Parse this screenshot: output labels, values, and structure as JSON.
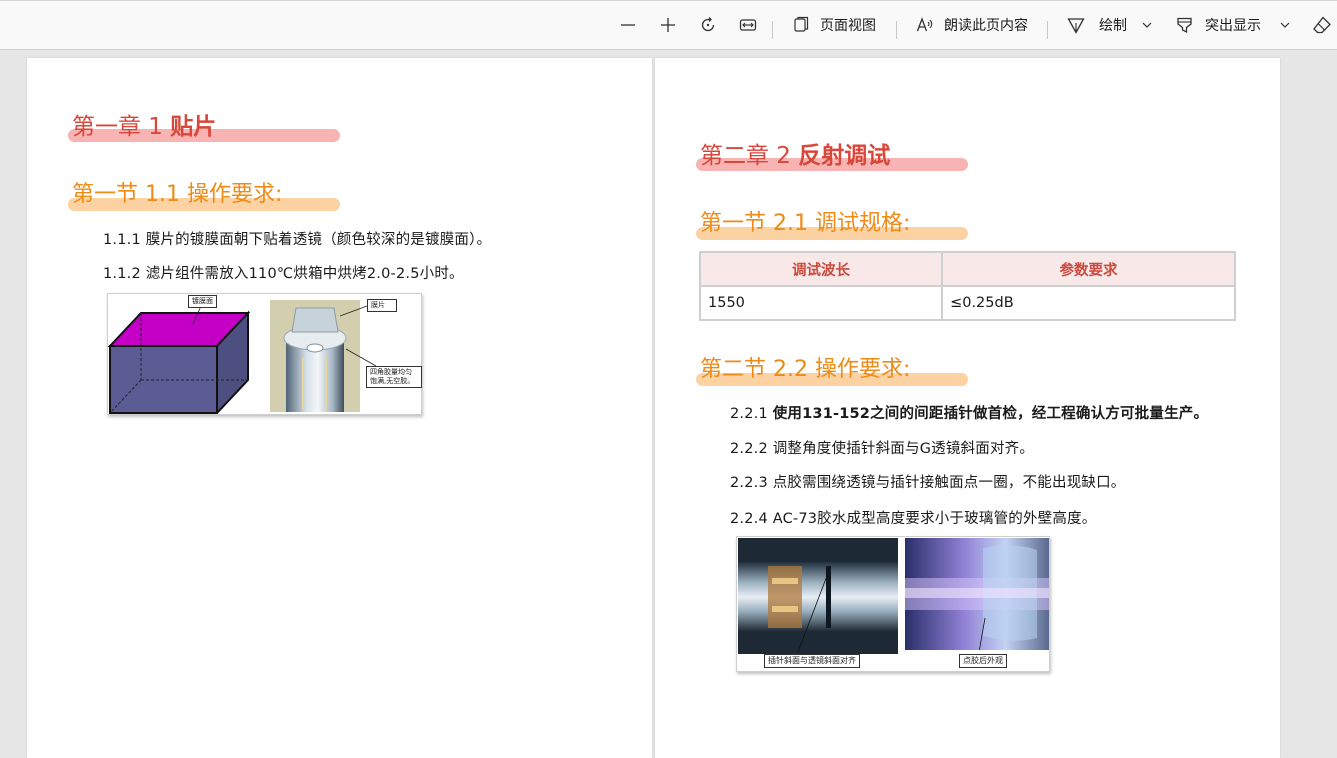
{
  "toolbar": {
    "zoom_out": "zoom-out",
    "zoom_in": "zoom-in",
    "rotate": "rotate",
    "fit_width": "fit-width",
    "page_view_label": "页面视图",
    "read_aloud_label": "朗读此页内容",
    "draw_label": "绘制",
    "highlight_label": "突出显示"
  },
  "left_page": {
    "chapter_prefix": "第一章  1 ",
    "chapter_title": "贴片",
    "section_title": "第一节  1.1 操作要求:",
    "items": [
      "1.1.1 膜片的镀膜面朝下贴着透镜（颜色较深的是镀膜面）。",
      "1.1.2 滤片组件需放入110℃烘箱中烘烤2.0-2.5小时。"
    ],
    "figure_callouts": {
      "coated_face": "镀膜面",
      "film": "膜片",
      "glue_note": "四角胶量均匀饱满,无空胶。"
    }
  },
  "right_page": {
    "chapter_prefix": "第二章  2 ",
    "chapter_title": "反射调试",
    "section1_title": "第一节  2.1 调试规格:",
    "table": {
      "headers": [
        "调试波长",
        "参数要求"
      ],
      "rows": [
        [
          "1550",
          "≤0.25dB"
        ]
      ]
    },
    "section2_title": "第二节  2.2 操作要求:",
    "item1_num": "2.2.1 ",
    "item1_text": "使用131-152之间的间距插针做首检，经工程确认方可批量生产。",
    "items": [
      "2.2.2 调整角度使插针斜面与G透镜斜面对齐。",
      "2.2.3 点胶需围绕透镜与插针接触面点一圈，不能出现缺口。",
      "2.2.4 AC-73胶水成型高度要求小于玻璃管的外壁高度。"
    ],
    "figure_callouts": {
      "align": "插针斜面与透镜斜面对齐",
      "after_glue": "点胶后外观"
    }
  },
  "colors": {
    "chapter_red": "#d9463a",
    "section_orange": "#ef8a17",
    "chapter_highlight": "#f7b4b2",
    "section_highlight": "#fcd2a3",
    "table_header_bg": "#f8e8e8"
  }
}
